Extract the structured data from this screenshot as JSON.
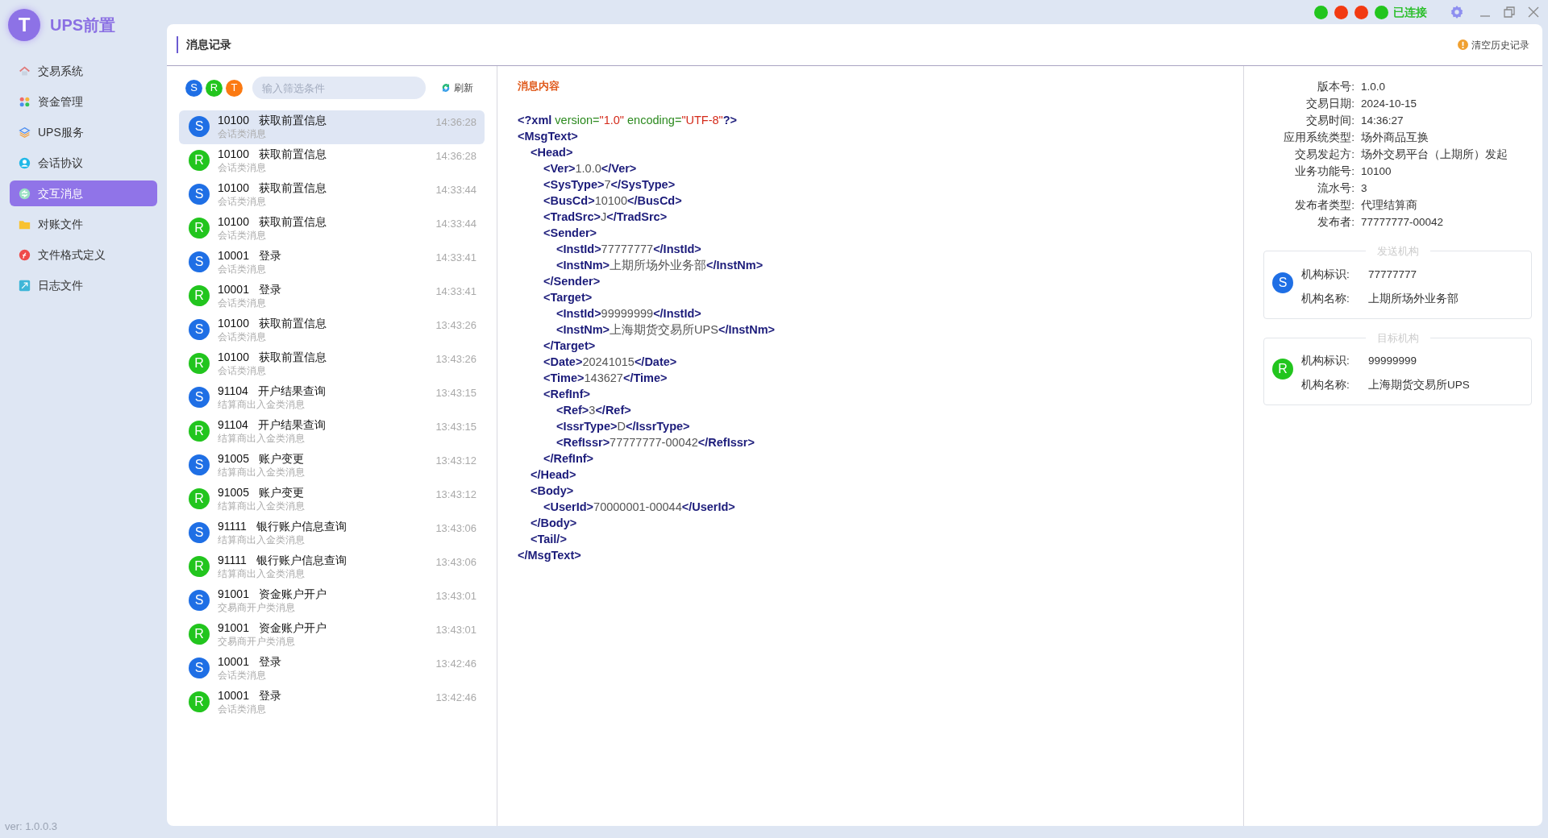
{
  "app": {
    "logo_letter": "T",
    "title": "UPS前置",
    "version": "ver: 1.0.0.3"
  },
  "sidebar": {
    "items": [
      {
        "kind": "home",
        "label": "交易系统",
        "selected": false
      },
      {
        "kind": "grid",
        "label": "资金管理",
        "selected": false
      },
      {
        "kind": "layers",
        "label": "UPS服务",
        "selected": false
      },
      {
        "kind": "user",
        "label": "会话协议",
        "selected": false
      },
      {
        "kind": "exchange",
        "label": "交互消息",
        "selected": true
      },
      {
        "kind": "folder",
        "label": "对账文件",
        "selected": false
      },
      {
        "kind": "format",
        "label": "文件格式定义",
        "selected": false
      },
      {
        "kind": "log",
        "label": "日志文件",
        "selected": false
      }
    ]
  },
  "status": {
    "dots": [
      {
        "color": "#22c51e"
      },
      {
        "color": "#f23a12"
      },
      {
        "color": "#f23a12"
      },
      {
        "color": "#22c51e"
      }
    ],
    "label": "已连接"
  },
  "page": {
    "title": "消息记录",
    "clear_button": "清空历史记录"
  },
  "filter": {
    "chips": [
      {
        "kind": "send",
        "letter": "S"
      },
      {
        "kind": "receive",
        "letter": "R"
      },
      {
        "kind": "other",
        "letter": "T"
      }
    ],
    "placeholder": "输入筛选条件",
    "refresh": "刷新"
  },
  "messages": [
    {
      "kind": "send",
      "letter": "S",
      "code": "10100",
      "name": "获取前置信息",
      "category": "会话类消息",
      "time": "14:36:28",
      "selected": true
    },
    {
      "kind": "receive",
      "letter": "R",
      "code": "10100",
      "name": "获取前置信息",
      "category": "会话类消息",
      "time": "14:36:28",
      "selected": false
    },
    {
      "kind": "send",
      "letter": "S",
      "code": "10100",
      "name": "获取前置信息",
      "category": "会话类消息",
      "time": "14:33:44",
      "selected": false
    },
    {
      "kind": "receive",
      "letter": "R",
      "code": "10100",
      "name": "获取前置信息",
      "category": "会话类消息",
      "time": "14:33:44",
      "selected": false
    },
    {
      "kind": "send",
      "letter": "S",
      "code": "10001",
      "name": "登录",
      "category": "会话类消息",
      "time": "14:33:41",
      "selected": false
    },
    {
      "kind": "receive",
      "letter": "R",
      "code": "10001",
      "name": "登录",
      "category": "会话类消息",
      "time": "14:33:41",
      "selected": false
    },
    {
      "kind": "send",
      "letter": "S",
      "code": "10100",
      "name": "获取前置信息",
      "category": "会话类消息",
      "time": "13:43:26",
      "selected": false
    },
    {
      "kind": "receive",
      "letter": "R",
      "code": "10100",
      "name": "获取前置信息",
      "category": "会话类消息",
      "time": "13:43:26",
      "selected": false
    },
    {
      "kind": "send",
      "letter": "S",
      "code": "91104",
      "name": "开户结果查询",
      "category": "结算商出入金类消息",
      "time": "13:43:15",
      "selected": false
    },
    {
      "kind": "receive",
      "letter": "R",
      "code": "91104",
      "name": "开户结果查询",
      "category": "结算商出入金类消息",
      "time": "13:43:15",
      "selected": false
    },
    {
      "kind": "send",
      "letter": "S",
      "code": "91005",
      "name": "账户变更",
      "category": "结算商出入金类消息",
      "time": "13:43:12",
      "selected": false
    },
    {
      "kind": "receive",
      "letter": "R",
      "code": "91005",
      "name": "账户变更",
      "category": "结算商出入金类消息",
      "time": "13:43:12",
      "selected": false
    },
    {
      "kind": "send",
      "letter": "S",
      "code": "91111",
      "name": "银行账户信息查询",
      "category": "结算商出入金类消息",
      "time": "13:43:06",
      "selected": false
    },
    {
      "kind": "receive",
      "letter": "R",
      "code": "91111",
      "name": "银行账户信息查询",
      "category": "结算商出入金类消息",
      "time": "13:43:06",
      "selected": false
    },
    {
      "kind": "send",
      "letter": "S",
      "code": "91001",
      "name": "资金账户开户",
      "category": "交易商开户类消息",
      "time": "13:43:01",
      "selected": false
    },
    {
      "kind": "receive",
      "letter": "R",
      "code": "91001",
      "name": "资金账户开户",
      "category": "交易商开户类消息",
      "time": "13:43:01",
      "selected": false
    },
    {
      "kind": "send",
      "letter": "S",
      "code": "10001",
      "name": "登录",
      "category": "会话类消息",
      "time": "13:42:46",
      "selected": false
    },
    {
      "kind": "receive",
      "letter": "R",
      "code": "10001",
      "name": "登录",
      "category": "会话类消息",
      "time": "13:42:46",
      "selected": false
    }
  ],
  "content": {
    "title": "消息内容",
    "declaration": [
      {
        "kind": "tag",
        "text": "<?xml"
      },
      {
        "kind": "attr",
        "text": " version="
      },
      {
        "kind": "string",
        "text": "\"1.0\""
      },
      {
        "kind": "attr",
        "text": " encoding="
      },
      {
        "kind": "string",
        "text": "\"UTF-8\""
      },
      {
        "kind": "tag",
        "text": "?>"
      }
    ],
    "xml": [
      {
        "open": "<MsgText>",
        "close": "</MsgText>",
        "children": [
          {
            "open": "<Head>",
            "close": "</Head>",
            "children": [
              {
                "open": "<Ver>",
                "value": "1.0.0",
                "close": "</Ver>"
              },
              {
                "open": "<SysType>",
                "value": "7",
                "close": "</SysType>"
              },
              {
                "open": "<BusCd>",
                "value": "10100",
                "close": "</BusCd>"
              },
              {
                "open": "<TradSrc>",
                "value": "J",
                "close": "</TradSrc>"
              },
              {
                "open": "<Sender>",
                "close": "</Sender>",
                "children": [
                  {
                    "open": "<InstId>",
                    "value": "77777777",
                    "close": "</InstId>"
                  },
                  {
                    "open": "<InstNm>",
                    "value": "上期所场外业务部",
                    "close": "</InstNm>"
                  }
                ]
              },
              {
                "open": "<Target>",
                "close": "</Target>",
                "children": [
                  {
                    "open": "<InstId>",
                    "value": "99999999",
                    "close": "</InstId>"
                  },
                  {
                    "open": "<InstNm>",
                    "value": "上海期货交易所UPS",
                    "close": "</InstNm>"
                  }
                ]
              },
              {
                "open": "<Date>",
                "value": "20241015",
                "close": "</Date>"
              },
              {
                "open": "<Time>",
                "value": "143627",
                "close": "</Time>"
              },
              {
                "open": "<RefInf>",
                "close": "</RefInf>",
                "children": [
                  {
                    "open": "<Ref>",
                    "value": "3",
                    "close": "</Ref>"
                  },
                  {
                    "open": "<IssrType>",
                    "value": "D",
                    "close": "</IssrType>"
                  },
                  {
                    "open": "<RefIssr>",
                    "value": "77777777-00042",
                    "close": "</RefIssr>"
                  }
                ]
              }
            ]
          },
          {
            "open": "<Body>",
            "close": "</Body>",
            "children": [
              {
                "open": "<UserId>",
                "value": "70000001-00044",
                "close": "</UserId>"
              }
            ]
          },
          {
            "open": "<Tail/>"
          }
        ]
      }
    ]
  },
  "details": {
    "fields": [
      {
        "label": "版本号:",
        "value": "1.0.0"
      },
      {
        "label": "交易日期:",
        "value": "2024-10-15"
      },
      {
        "label": "交易时间:",
        "value": "14:36:27"
      },
      {
        "label": "应用系统类型:",
        "value": "场外商品互换"
      },
      {
        "label": "交易发起方:",
        "value": "场外交易平台（上期所）发起"
      },
      {
        "label": "业务功能号:",
        "value": "10100"
      },
      {
        "label": "流水号:",
        "value": "3"
      },
      {
        "label": "发布者类型:",
        "value": "代理结算商"
      },
      {
        "label": "发布者:",
        "value": "77777777-00042"
      }
    ],
    "cards": [
      {
        "title": "发送机构",
        "kind": "send",
        "letter": "S",
        "fields": [
          {
            "label": "机构标识:",
            "value": "77777777"
          },
          {
            "label": "机构名称:",
            "value": "上期所场外业务部"
          }
        ]
      },
      {
        "title": "目标机构",
        "kind": "receive",
        "letter": "R",
        "fields": [
          {
            "label": "机构标识:",
            "value": "99999999"
          },
          {
            "label": "机构名称:",
            "value": "上海期货交易所UPS"
          }
        ]
      }
    ]
  }
}
